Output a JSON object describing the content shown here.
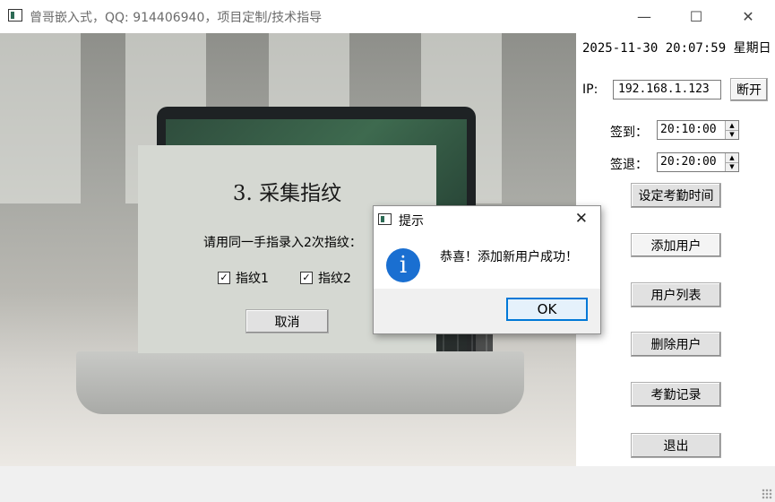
{
  "window": {
    "title": "曾哥嵌入式，QQ: 914406940，项目定制/技术指导",
    "minimize_glyph": "—",
    "maximize_glyph": "☐",
    "close_glyph": "✕"
  },
  "panel": {
    "datetime": "2025-11-30 20:07:59 星期日",
    "ip_label": "IP:",
    "ip_value": "192.168.1.123",
    "disconnect_label": "断开",
    "checkin_label": "签到：",
    "checkin_time": "20:10:00",
    "checkout_label": "签退：",
    "checkout_time": "20:20:00",
    "set_time_label": "设定考勤时间",
    "add_user_label": "添加用户",
    "user_list_label": "用户列表",
    "delete_user_label": "删除用户",
    "attendance_log_label": "考勤记录",
    "exit_label": "退出"
  },
  "fingerprint_dialog": {
    "title": "3. 采集指纹",
    "prompt": "请用同一手指录入2次指纹：",
    "fp1_label": "指纹1",
    "fp2_label": "指纹2",
    "fp1_checked": true,
    "fp2_checked": true,
    "cancel_label": "取消",
    "check_glyph": "✓"
  },
  "message_box": {
    "title": "提示",
    "message": "恭喜！添加新用户成功！",
    "ok_label": "OK",
    "info_glyph": "i",
    "close_glyph": "✕"
  },
  "icons": {
    "app": "app-window-icon",
    "info": "info-icon",
    "spin_up": "▲",
    "spin_down": "▼"
  },
  "colors": {
    "accent": "#0078d7",
    "info_blue": "#1a6fd1",
    "dialog_bg": "#d5d8d2"
  }
}
